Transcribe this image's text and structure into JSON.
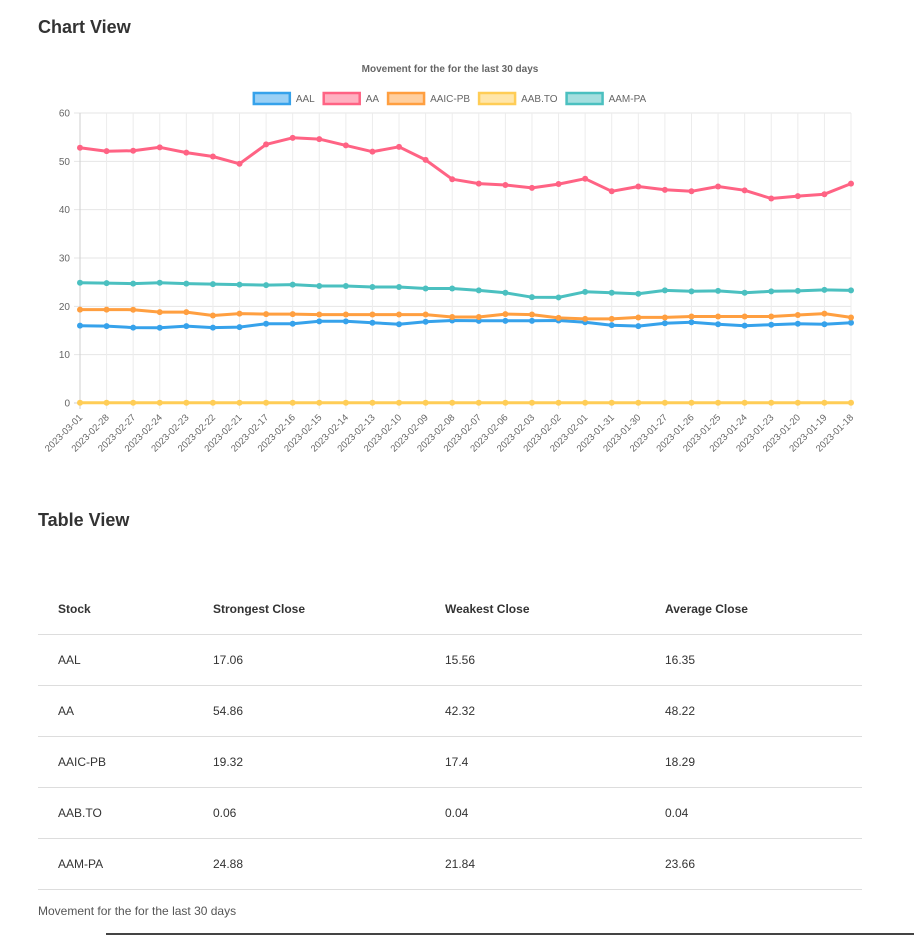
{
  "chart_section": {
    "title": "Chart View"
  },
  "table_section": {
    "title": "Table View",
    "caption": "Movement for the for the last 30 days"
  },
  "chart_data": {
    "type": "line",
    "title": "Movement for the for the last 30 days",
    "ylim": [
      0,
      60
    ],
    "yticks": [
      0,
      10,
      20,
      30,
      40,
      50,
      60
    ],
    "grid": true,
    "legend_position": "top",
    "categories": [
      "2023-03-01",
      "2023-02-28",
      "2023-02-27",
      "2023-02-24",
      "2023-02-23",
      "2023-02-22",
      "2023-02-21",
      "2023-02-17",
      "2023-02-16",
      "2023-02-15",
      "2023-02-14",
      "2023-02-13",
      "2023-02-10",
      "2023-02-09",
      "2023-02-08",
      "2023-02-07",
      "2023-02-06",
      "2023-02-03",
      "2023-02-02",
      "2023-02-01",
      "2023-01-31",
      "2023-01-30",
      "2023-01-27",
      "2023-01-26",
      "2023-01-25",
      "2023-01-24",
      "2023-01-23",
      "2023-01-20",
      "2023-01-19",
      "2023-01-18"
    ],
    "series": [
      {
        "name": "AAL",
        "color": "#36a2eb",
        "values": [
          16.0,
          15.9,
          15.6,
          15.56,
          15.9,
          15.6,
          15.7,
          16.4,
          16.4,
          16.9,
          16.9,
          16.6,
          16.3,
          16.8,
          17.06,
          17.0,
          17.0,
          17.0,
          17.06,
          16.7,
          16.1,
          15.9,
          16.5,
          16.7,
          16.3,
          16.0,
          16.2,
          16.4,
          16.3,
          16.6
        ]
      },
      {
        "name": "AA",
        "color": "#ff6384",
        "values": [
          52.8,
          52.1,
          52.2,
          52.9,
          51.8,
          51.0,
          49.5,
          53.5,
          54.86,
          54.6,
          53.3,
          52.0,
          53.0,
          50.3,
          46.3,
          45.4,
          45.1,
          44.5,
          45.3,
          46.4,
          43.8,
          44.8,
          44.1,
          43.8,
          44.8,
          44.0,
          42.32,
          42.8,
          43.2,
          45.4
        ]
      },
      {
        "name": "AAIC-PB",
        "color": "#ff9f40",
        "values": [
          19.32,
          19.32,
          19.3,
          18.8,
          18.8,
          18.1,
          18.5,
          18.4,
          18.4,
          18.3,
          18.3,
          18.3,
          18.3,
          18.3,
          17.8,
          17.8,
          18.4,
          18.3,
          17.6,
          17.4,
          17.4,
          17.7,
          17.7,
          17.9,
          17.9,
          17.9,
          17.9,
          18.2,
          18.5,
          17.7
        ]
      },
      {
        "name": "AAB.TO",
        "color": "#ffcd56",
        "values": [
          0.04,
          0.04,
          0.04,
          0.04,
          0.04,
          0.04,
          0.04,
          0.04,
          0.04,
          0.04,
          0.04,
          0.04,
          0.04,
          0.04,
          0.04,
          0.04,
          0.04,
          0.04,
          0.04,
          0.04,
          0.04,
          0.04,
          0.04,
          0.04,
          0.04,
          0.04,
          0.04,
          0.04,
          0.04,
          0.06
        ]
      },
      {
        "name": "AAM-PA",
        "color": "#4bc0c0",
        "values": [
          24.88,
          24.8,
          24.7,
          24.88,
          24.7,
          24.6,
          24.5,
          24.4,
          24.5,
          24.2,
          24.2,
          24.0,
          24.0,
          23.7,
          23.7,
          23.3,
          22.8,
          21.9,
          21.84,
          23.0,
          22.8,
          22.6,
          23.3,
          23.1,
          23.2,
          22.8,
          23.1,
          23.2,
          23.4,
          23.3
        ]
      }
    ]
  },
  "table": {
    "headers": [
      "Stock",
      "Strongest Close",
      "Weakest Close",
      "Average Close"
    ],
    "rows": [
      [
        "AAL",
        "17.06",
        "15.56",
        "16.35"
      ],
      [
        "AA",
        "54.86",
        "42.32",
        "48.22"
      ],
      [
        "AAIC-PB",
        "19.32",
        "17.4",
        "18.29"
      ],
      [
        "AAB.TO",
        "0.06",
        "0.04",
        "0.04"
      ],
      [
        "AAM-PA",
        "24.88",
        "21.84",
        "23.66"
      ]
    ]
  }
}
